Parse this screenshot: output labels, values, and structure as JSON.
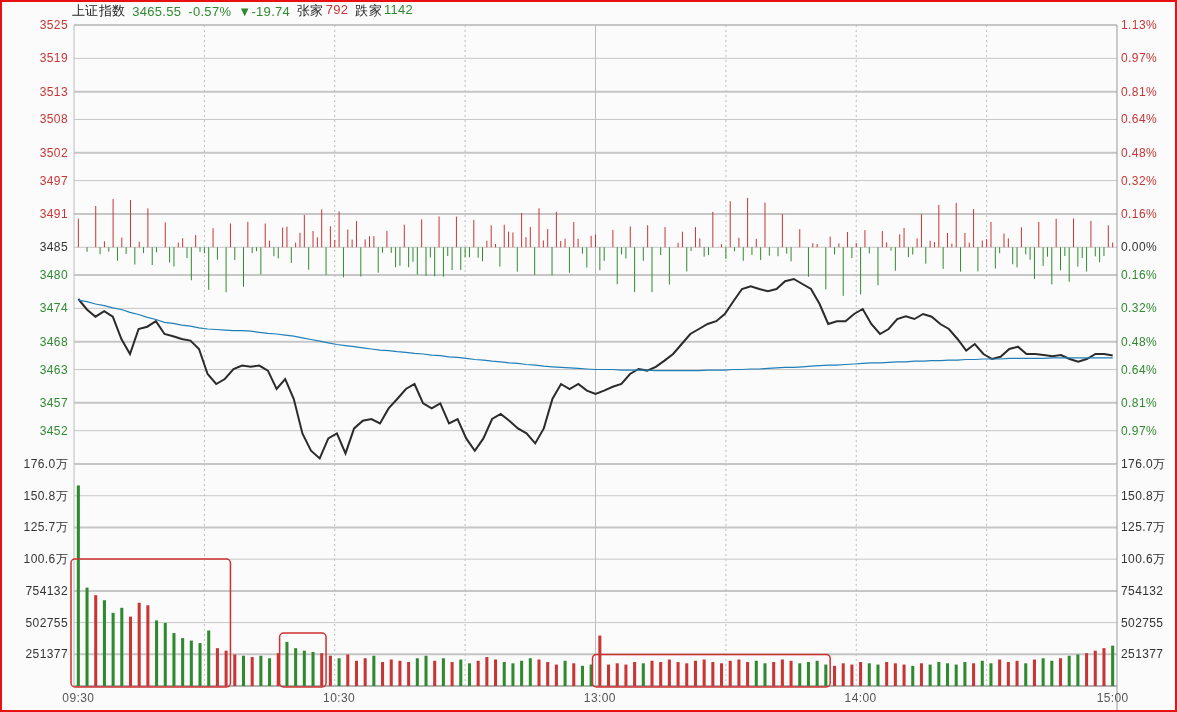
{
  "header": {
    "name": "上证指数",
    "price": "3465.55",
    "change_pct": "-0.57%",
    "change": "▼-19.74",
    "advancers_label": "张家",
    "advancers": "792",
    "decliners_label": "跌家",
    "decliners": "1142"
  },
  "percent_axis": [
    {
      "label": "1.13%",
      "color": "#c83535"
    },
    {
      "label": "0.97%",
      "color": "#c83535"
    },
    {
      "label": "0.81%",
      "color": "#c83535"
    },
    {
      "label": "0.64%",
      "color": "#c83535"
    },
    {
      "label": "0.48%",
      "color": "#c83535"
    },
    {
      "label": "0.32%",
      "color": "#c83535"
    },
    {
      "label": "0.16%",
      "color": "#c83535"
    },
    {
      "label": "0.00%",
      "color": "#333333"
    },
    {
      "label": "0.16%",
      "color": "#2f8a2f"
    },
    {
      "label": "0.32%",
      "color": "#2f8a2f"
    },
    {
      "label": "0.48%",
      "color": "#2f8a2f"
    },
    {
      "label": "0.64%",
      "color": "#2f8a2f"
    },
    {
      "label": "0.81%",
      "color": "#2f8a2f"
    },
    {
      "label": "0.97%",
      "color": "#2f8a2f"
    }
  ],
  "price_chart": {
    "chart_data": {
      "type": "line",
      "grid": true,
      "ylim": [
        3446,
        3525
      ],
      "yticks": [
        {
          "value": 3525,
          "label": "3525"
        },
        {
          "value": 3519,
          "label": "3519"
        },
        {
          "value": 3513,
          "label": "3513"
        },
        {
          "value": 3508,
          "label": "3508"
        },
        {
          "value": 3502,
          "label": "3502"
        },
        {
          "value": 3497,
          "label": "3497"
        },
        {
          "value": 3491,
          "label": "3491"
        },
        {
          "value": 3485,
          "label": "3485"
        },
        {
          "value": 3480,
          "label": "3480"
        },
        {
          "value": 3474,
          "label": "3474"
        },
        {
          "value": 3468,
          "label": "3468"
        },
        {
          "value": 3463,
          "label": "3463"
        },
        {
          "value": 3457,
          "label": "3457"
        },
        {
          "value": 3452,
          "label": "3452"
        }
      ],
      "categories": [
        null,
        null,
        null,
        null,
        null,
        null,
        null,
        null,
        null,
        null,
        null,
        null,
        null,
        null,
        null,
        null,
        null,
        null,
        null,
        null,
        null,
        null,
        null,
        null,
        null,
        null,
        null,
        null,
        null,
        null,
        null,
        null,
        null,
        null,
        null,
        null,
        null,
        null,
        null,
        null,
        null,
        null,
        null,
        null,
        null,
        null,
        null,
        null,
        null,
        null,
        null,
        null,
        null,
        null,
        null,
        null,
        null,
        null,
        null,
        null,
        null,
        null,
        null,
        null,
        null,
        null,
        null,
        null,
        null,
        null,
        null,
        null,
        null,
        null,
        null,
        null,
        null,
        null,
        null,
        null,
        null,
        null,
        null,
        null,
        null,
        null,
        null,
        null,
        null,
        null,
        null,
        null,
        null,
        null,
        null,
        null,
        null,
        null,
        null,
        null,
        null,
        null,
        null,
        null,
        null,
        null,
        null,
        null,
        null,
        null,
        null,
        null,
        null,
        null,
        null,
        null,
        null,
        null,
        null,
        null,
        null
      ],
      "series": [
        {
          "color": "#2b2b2b",
          "values": [
            3475.7,
            3473.8,
            3472.5,
            3473.5,
            3472.5,
            3468.5,
            3465.8,
            3470.3,
            3470.7,
            3471.7,
            3469.4,
            3469.0,
            3468.5,
            3468.2,
            3466.7,
            3462.2,
            3460.4,
            3461.3,
            3463.1,
            3463.7,
            3463.5,
            3463.7,
            3462.8,
            3459.5,
            3461.3,
            3457.7,
            3451.5,
            3448.4,
            3447.0,
            3450.6,
            3451.5,
            3447.9,
            3452.4,
            3453.8,
            3454.1,
            3453.3,
            3456.0,
            3457.7,
            3459.5,
            3460.4,
            3456.9,
            3456.0,
            3456.9,
            3453.3,
            3454.1,
            3450.6,
            3448.4,
            3450.6,
            3454.1,
            3455.0,
            3453.8,
            3452.4,
            3451.5,
            3449.7,
            3452.4,
            3457.7,
            3460.4,
            3459.5,
            3460.4,
            3459.2,
            3458.6,
            3459.2,
            3459.9,
            3460.4,
            3462.2,
            3463.1,
            3462.8,
            3463.5,
            3464.6,
            3465.8,
            3467.6,
            3469.4,
            3470.3,
            3471.2,
            3471.7,
            3473.0,
            3475.3,
            3477.5,
            3478.0,
            3477.5,
            3477.1,
            3477.5,
            3478.9,
            3479.3,
            3478.4,
            3477.5,
            3474.8,
            3471.2,
            3471.7,
            3471.7,
            3473.0,
            3473.9,
            3471.2,
            3469.4,
            3470.3,
            3472.1,
            3472.6,
            3472.1,
            3473.0,
            3472.5,
            3471.2,
            3470.3,
            3468.5,
            3466.4,
            3467.6,
            3465.8,
            3464.9,
            3465.3,
            3466.7,
            3467.1,
            3465.8,
            3465.8,
            3465.6,
            3465.4,
            3465.6,
            3464.9,
            3464.4,
            3464.9,
            3465.8,
            3465.8,
            3465.5
          ]
        },
        {
          "color": "#1f7fb8",
          "values": [
            3475.5,
            3475.2,
            3474.8,
            3474.5,
            3474.1,
            3473.8,
            3473.3,
            3472.9,
            3472.4,
            3472.0,
            3471.5,
            3471.3,
            3471.0,
            3470.8,
            3470.5,
            3470.3,
            3470.2,
            3470.1,
            3470.0,
            3470.0,
            3469.9,
            3469.7,
            3469.5,
            3469.4,
            3469.2,
            3469.0,
            3468.7,
            3468.4,
            3468.1,
            3467.8,
            3467.5,
            3467.3,
            3467.1,
            3466.9,
            3466.7,
            3466.5,
            3466.4,
            3466.2,
            3466.1,
            3465.9,
            3465.8,
            3465.6,
            3465.5,
            3465.3,
            3465.2,
            3465.0,
            3464.8,
            3464.7,
            3464.5,
            3464.4,
            3464.2,
            3464.1,
            3463.9,
            3463.8,
            3463.6,
            3463.5,
            3463.4,
            3463.3,
            3463.2,
            3463.1,
            3463.0,
            3463.0,
            3463.0,
            3462.9,
            3462.9,
            3462.9,
            3462.9,
            3462.8,
            3462.8,
            3462.8,
            3462.8,
            3462.8,
            3462.8,
            3462.9,
            3462.9,
            3462.9,
            3463.0,
            3463.0,
            3463.1,
            3463.1,
            3463.2,
            3463.3,
            3463.4,
            3463.4,
            3463.5,
            3463.6,
            3463.7,
            3463.8,
            3463.8,
            3463.9,
            3464.0,
            3464.1,
            3464.2,
            3464.2,
            3464.3,
            3464.4,
            3464.4,
            3464.5,
            3464.5,
            3464.6,
            3464.6,
            3464.7,
            3464.7,
            3464.8,
            3464.8,
            3464.9,
            3464.9,
            3464.9,
            3465.0,
            3465.0,
            3465.0,
            3465.0,
            3465.0,
            3465.1,
            3465.1,
            3465.1,
            3465.1,
            3465.1,
            3465.1,
            3465.1,
            3465.1
          ]
        }
      ]
    }
  },
  "volume_chart": {
    "upper_axis_labels": [
      "176.0万",
      "150.8万",
      "125.7万",
      "100.6万"
    ],
    "chart_data": {
      "type": "bar",
      "grid": true,
      "ylim": [
        0,
        1760000
      ],
      "yticks": [
        {
          "value": 251377,
          "label": "251377"
        },
        {
          "value": 502755,
          "label": "502755"
        },
        {
          "value": 754132,
          "label": "754132"
        }
      ],
      "categories": [
        "09:30",
        null,
        null,
        null,
        null,
        null,
        null,
        null,
        null,
        null,
        null,
        null,
        null,
        null,
        null,
        null,
        null,
        null,
        null,
        null,
        null,
        null,
        null,
        null,
        null,
        null,
        null,
        null,
        null,
        null,
        "10:30",
        null,
        null,
        null,
        null,
        null,
        null,
        null,
        null,
        null,
        null,
        null,
        null,
        null,
        null,
        null,
        null,
        null,
        null,
        null,
        null,
        null,
        null,
        null,
        null,
        null,
        null,
        null,
        null,
        null,
        "13:00",
        null,
        null,
        null,
        null,
        null,
        null,
        null,
        null,
        null,
        null,
        null,
        null,
        null,
        null,
        null,
        null,
        null,
        null,
        null,
        null,
        null,
        null,
        null,
        null,
        null,
        null,
        null,
        null,
        null,
        "14:00",
        null,
        null,
        null,
        null,
        null,
        null,
        null,
        null,
        null,
        null,
        null,
        null,
        null,
        null,
        null,
        null,
        null,
        null,
        null,
        null,
        null,
        null,
        null,
        null,
        null,
        null,
        null,
        null,
        "15:00"
      ],
      "values": [
        1590000,
        780000,
        720000,
        680000,
        580000,
        620000,
        550000,
        660000,
        640000,
        520000,
        500000,
        420000,
        380000,
        360000,
        340000,
        440000,
        300000,
        280000,
        250000,
        240000,
        230000,
        240000,
        220000,
        260000,
        350000,
        300000,
        280000,
        270000,
        260000,
        240000,
        220000,
        250000,
        200000,
        220000,
        240000,
        190000,
        210000,
        200000,
        190000,
        220000,
        240000,
        200000,
        220000,
        190000,
        210000,
        180000,
        200000,
        230000,
        210000,
        190000,
        180000,
        200000,
        220000,
        210000,
        190000,
        170000,
        200000,
        180000,
        160000,
        170000,
        400000,
        170000,
        180000,
        170000,
        190000,
        180000,
        200000,
        190000,
        210000,
        190000,
        180000,
        200000,
        210000,
        190000,
        180000,
        200000,
        210000,
        190000,
        200000,
        180000,
        190000,
        210000,
        200000,
        180000,
        190000,
        200000,
        170000,
        160000,
        180000,
        170000,
        190000,
        180000,
        170000,
        190000,
        180000,
        170000,
        160000,
        180000,
        170000,
        190000,
        180000,
        170000,
        190000,
        180000,
        200000,
        180000,
        210000,
        190000,
        200000,
        180000,
        210000,
        220000,
        200000,
        220000,
        240000,
        250000,
        260000,
        280000,
        300000,
        320000
      ]
    }
  },
  "volume_right_axis": [
    "176.0万",
    "150.8万",
    "125.7万",
    "100.6万",
    "754132",
    "502755",
    "251377"
  ]
}
